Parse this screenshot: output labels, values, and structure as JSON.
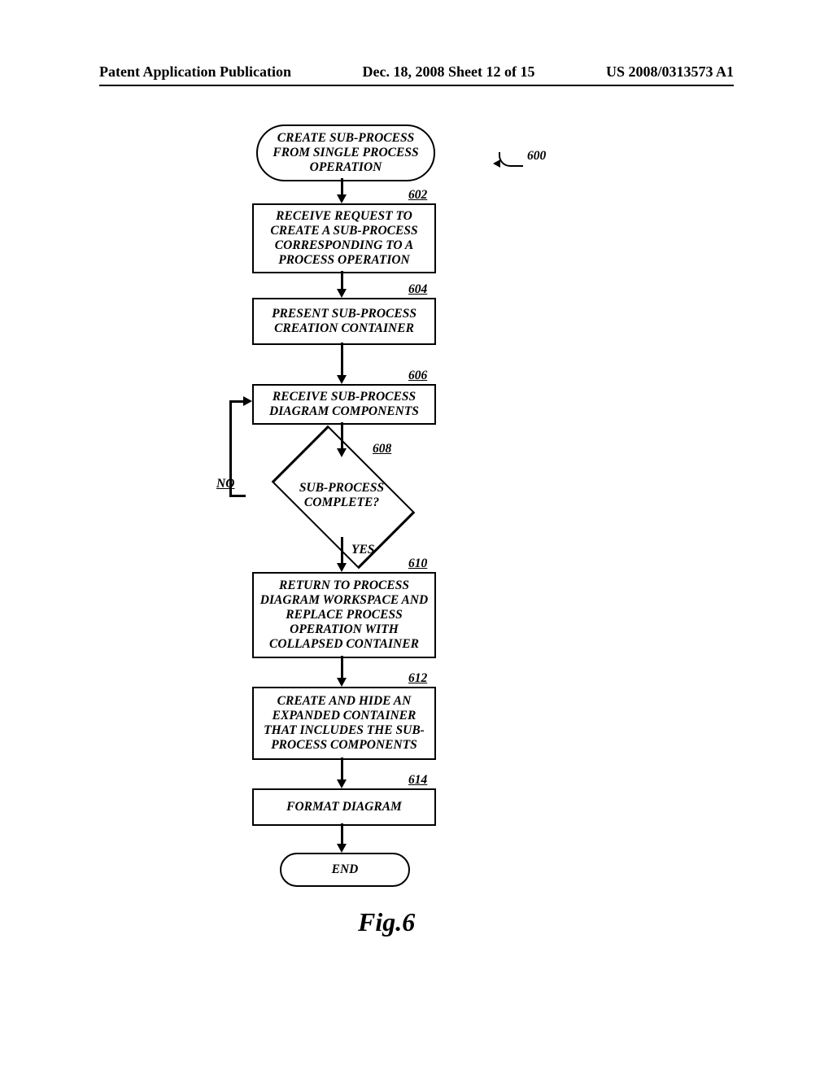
{
  "header": {
    "left": "Patent Application Publication",
    "mid": "Dec. 18, 2008  Sheet 12 of 15",
    "right": "US 2008/0313573 A1"
  },
  "refs": {
    "r600": "600",
    "r602": "602",
    "r604": "604",
    "r606": "606",
    "r608": "608",
    "r610": "610",
    "r612": "612",
    "r614": "614"
  },
  "nodes": {
    "start": "CREATE SUB-PROCESS FROM SINGLE PROCESS OPERATION",
    "n602": "RECEIVE REQUEST TO CREATE A SUB-PROCESS CORRESPONDING TO A PROCESS OPERATION",
    "n604": "PRESENT SUB-PROCESS CREATION CONTAINER",
    "n606": "RECEIVE SUB-PROCESS DIAGRAM COMPONENTS",
    "n608": "SUB-PROCESS COMPLETE?",
    "n610": "RETURN TO PROCESS DIAGRAM WORKSPACE AND REPLACE PROCESS OPERATION WITH COLLAPSED CONTAINER",
    "n612": "CREATE AND HIDE AN EXPANDED CONTAINER THAT INCLUDES THE SUB-PROCESS COMPONENTS",
    "n614": "FORMAT DIAGRAM",
    "end": "END"
  },
  "labels": {
    "no": "NO",
    "yes": "YES"
  },
  "figure": "Fig.6",
  "chart_data": {
    "type": "flowchart",
    "title": "Fig.6",
    "ref": "600",
    "nodes": [
      {
        "id": "start",
        "kind": "terminator",
        "text": "CREATE SUB-PROCESS FROM SINGLE PROCESS OPERATION"
      },
      {
        "id": "602",
        "kind": "process",
        "text": "RECEIVE REQUEST TO CREATE A SUB-PROCESS CORRESPONDING TO A PROCESS OPERATION"
      },
      {
        "id": "604",
        "kind": "process",
        "text": "PRESENT SUB-PROCESS CREATION CONTAINER"
      },
      {
        "id": "606",
        "kind": "process",
        "text": "RECEIVE SUB-PROCESS DIAGRAM COMPONENTS"
      },
      {
        "id": "608",
        "kind": "decision",
        "text": "SUB-PROCESS COMPLETE?"
      },
      {
        "id": "610",
        "kind": "process",
        "text": "RETURN TO PROCESS DIAGRAM WORKSPACE AND REPLACE PROCESS OPERATION WITH COLLAPSED CONTAINER"
      },
      {
        "id": "612",
        "kind": "process",
        "text": "CREATE AND HIDE AN EXPANDED CONTAINER THAT INCLUDES THE SUB-PROCESS COMPONENTS"
      },
      {
        "id": "614",
        "kind": "process",
        "text": "FORMAT DIAGRAM"
      },
      {
        "id": "end",
        "kind": "terminator",
        "text": "END"
      }
    ],
    "edges": [
      {
        "from": "start",
        "to": "602"
      },
      {
        "from": "602",
        "to": "604"
      },
      {
        "from": "604",
        "to": "606"
      },
      {
        "from": "606",
        "to": "608"
      },
      {
        "from": "608",
        "to": "606",
        "label": "NO"
      },
      {
        "from": "608",
        "to": "610",
        "label": "YES"
      },
      {
        "from": "610",
        "to": "612"
      },
      {
        "from": "612",
        "to": "614"
      },
      {
        "from": "614",
        "to": "end"
      }
    ]
  }
}
